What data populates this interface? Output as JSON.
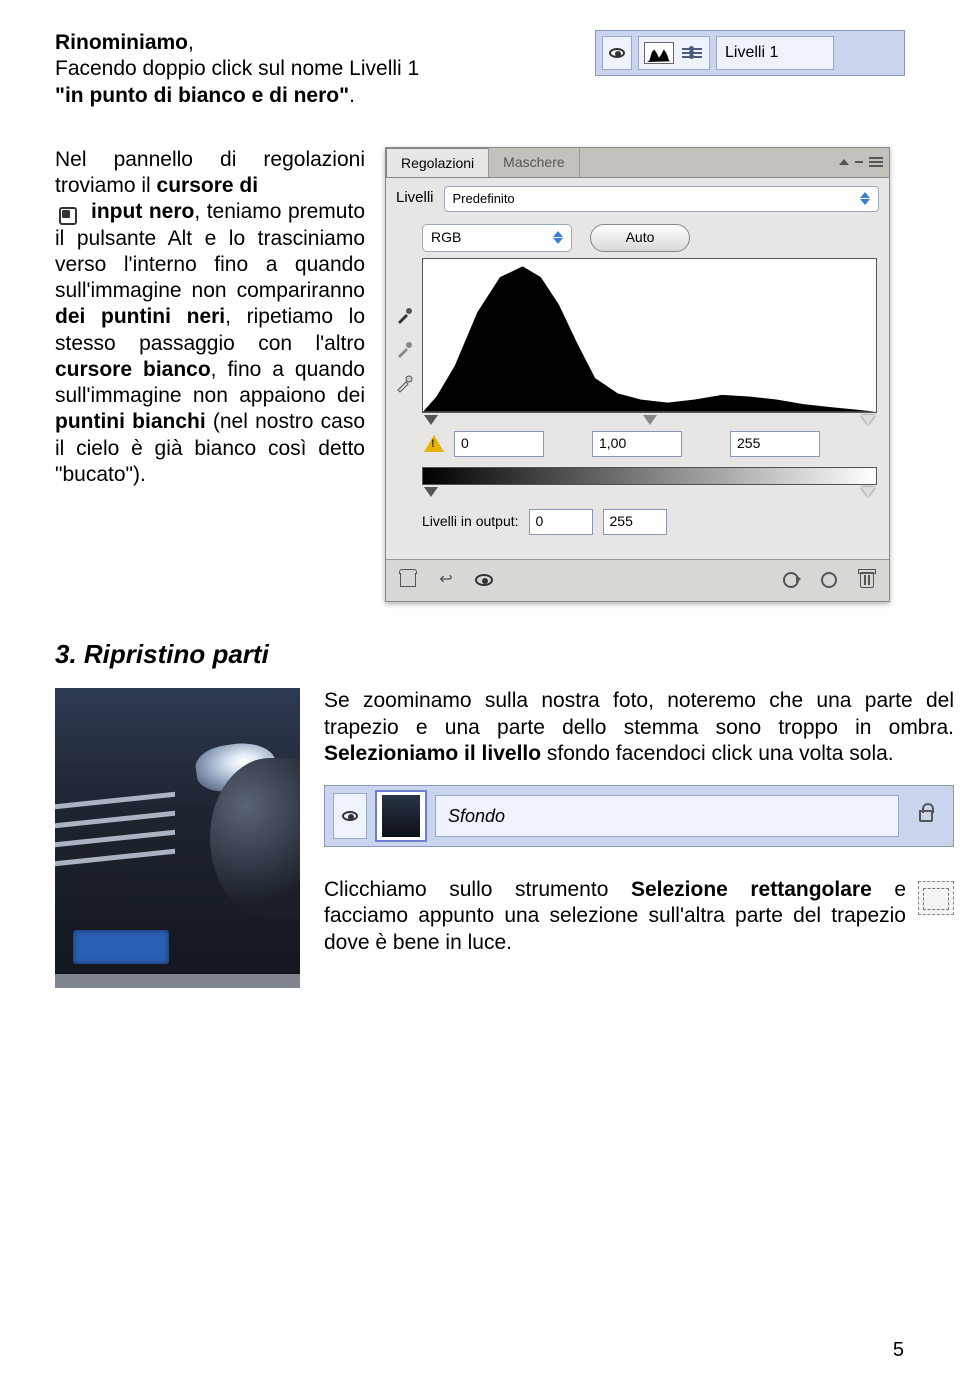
{
  "intro": {
    "line1_bold": "Rinominiamo",
    "line1_rest": ",",
    "line2": "Facendo doppio click sul nome Livelli 1",
    "line3_bold": "\"in punto di bianco e di nero\"",
    "line3_rest": "."
  },
  "layers_small": {
    "label": "Livelli 1"
  },
  "para2": {
    "pre1": "Nel pannello di regolazioni troviamo il ",
    "b1": "cursore di",
    "indent_b": "input nero",
    "indent_rest": ", teniamo premuto il pulsante",
    "mid": "Alt e lo trasciniamo verso l'interno fino a quando sull'immagine non compariranno ",
    "b2": "dei puntini neri",
    "mid2": ", ripetiamo lo stesso passaggio con l'altro ",
    "b3": "cursore bianco",
    "mid3": ", fino a quando sull'immagine non appaiono dei ",
    "b4": "puntini bianchi",
    "end": " (nel nostro caso il cielo è già bianco così detto \"bucato\")."
  },
  "adj": {
    "tab_active": "Regolazioni",
    "tab_other": "Maschere",
    "livelli": "Livelli",
    "preset": "Predefinito",
    "rgb": "RGB",
    "auto": "Auto",
    "in_black": "0",
    "in_gamma": "1,00",
    "in_white": "255",
    "out_label": "Livelli in output:",
    "out_black": "0",
    "out_white": "255"
  },
  "section3": {
    "heading": "3. Ripristino parti",
    "p1a": "Se zoominamo sulla nostra foto, noteremo che una parte del trapezio e una parte dello stemma sono troppo in ombra. ",
    "p1b": "Selezioniamo il livello",
    "p1c": " sfondo facendoci click una volta sola.",
    "sfondo": "Sfondo",
    "p2a": "Clicchiamo sullo strumento ",
    "p2b": "Selezione rettangolare",
    "p2c": "  e facciamo appunto una selezione sull'altra parte del trapezio dove è bene in luce."
  },
  "pagenum": "5"
}
